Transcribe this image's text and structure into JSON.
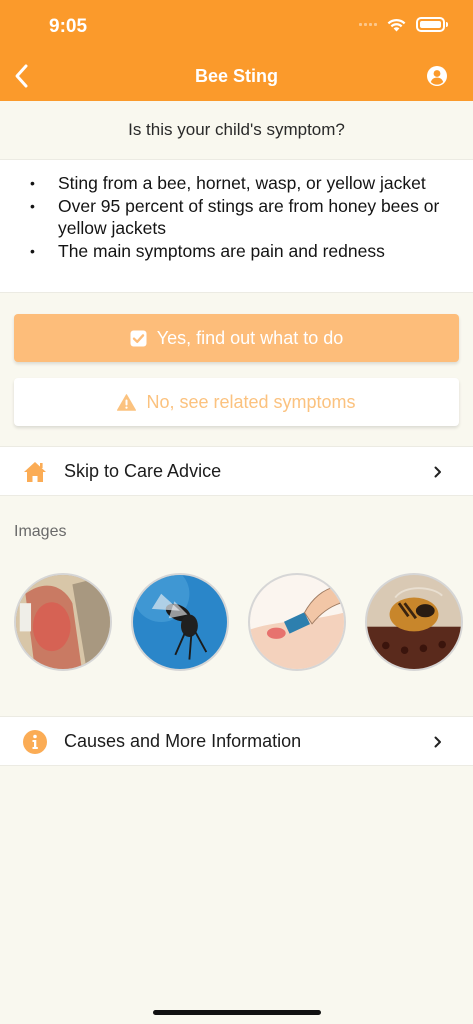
{
  "status_bar": {
    "time": "9:05"
  },
  "nav": {
    "title": "Bee Sting",
    "back_icon": "chevron-left-icon",
    "account_icon": "user-circle-icon"
  },
  "question": "Is this your child's symptom?",
  "bullets": [
    "Sting from a bee, hornet, wasp, or yellow jacket",
    "Over 95 percent of stings are from honey bees or yellow jackets",
    "The main symptoms are pain and redness"
  ],
  "buttons": {
    "yes_label": "Yes, find out what to do",
    "no_label": "No, see related symptoms"
  },
  "skip_row": {
    "label": "Skip to Care Advice",
    "icon": "home-icon"
  },
  "images": {
    "label": "Images"
  },
  "info_row": {
    "label": "Causes and More Information",
    "icon": "info-icon"
  },
  "colors": {
    "header": "#fb9a2b",
    "yes_button": "#fdbd7a",
    "no_button_text": "#fbc27f",
    "background": "#f9f8ef"
  }
}
